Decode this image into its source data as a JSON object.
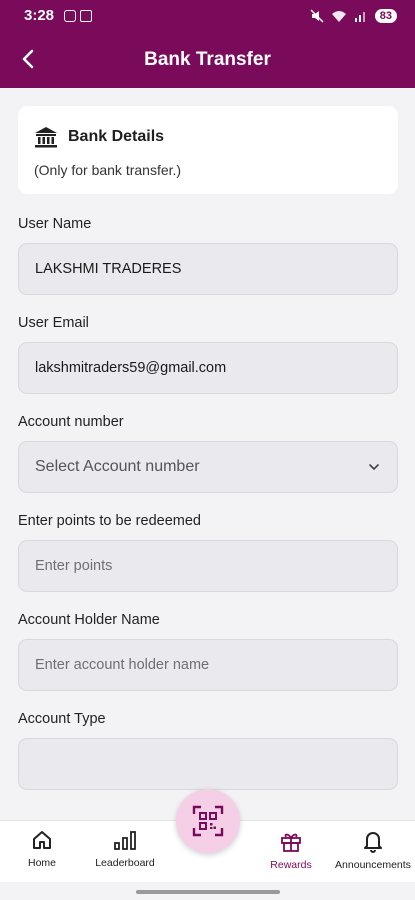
{
  "status_bar": {
    "time": "3:28",
    "battery": "83"
  },
  "header": {
    "title": "Bank Transfer"
  },
  "bank_card": {
    "title": "Bank Details",
    "subtitle": "(Only for bank transfer.)"
  },
  "form": {
    "user_name": {
      "label": "User Name",
      "value": "LAKSHMI TRADERES"
    },
    "user_email": {
      "label": "User Email",
      "value": "lakshmitraders59@gmail.com"
    },
    "account_number": {
      "label": "Account number",
      "selected": "Select Account number"
    },
    "points": {
      "label": "Enter points to be redeemed",
      "placeholder": "Enter points"
    },
    "holder_name": {
      "label": "Account Holder Name",
      "placeholder": "Enter account holder name"
    },
    "account_type": {
      "label": "Account Type",
      "value": ""
    }
  },
  "bottom_nav": {
    "items": [
      {
        "label": "Home",
        "icon": "home-icon"
      },
      {
        "label": "Leaderboard",
        "icon": "leaderboard-icon"
      },
      {
        "label": "Rewards",
        "icon": "gift-icon"
      },
      {
        "label": "Announcements",
        "icon": "bell-icon"
      }
    ],
    "fab_icon": "qr-scan-icon"
  },
  "colors": {
    "brand": "#7a0a5a",
    "fab_bg": "#f5cfe6",
    "field_bg": "#e9e9ee"
  }
}
